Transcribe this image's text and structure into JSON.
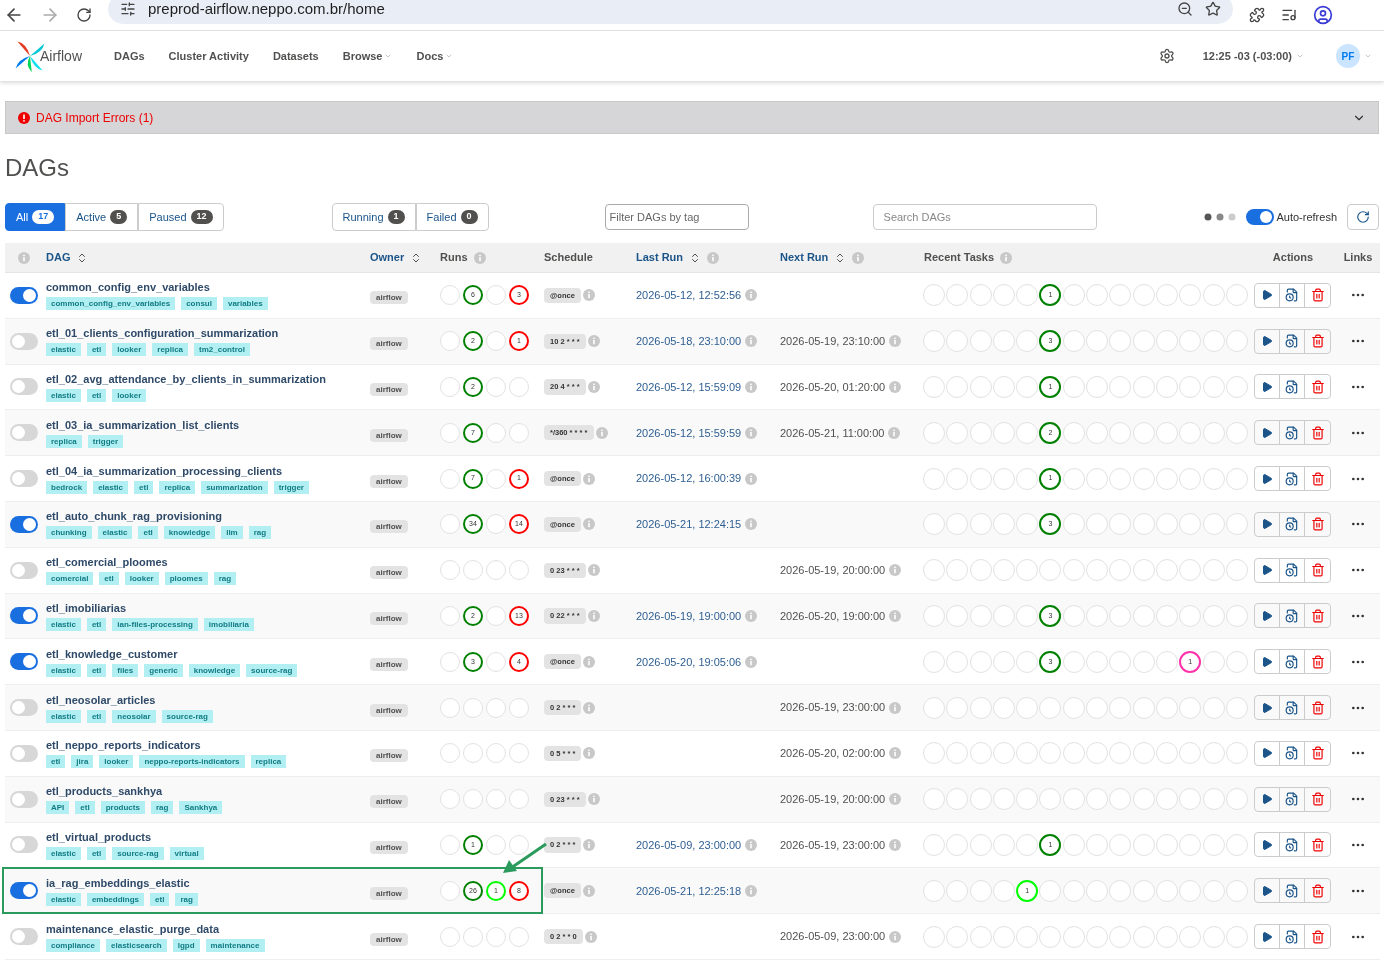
{
  "browser": {
    "url": "preprod-airflow.neppo.com.br/home"
  },
  "nav": {
    "brand": "Airflow",
    "items": [
      {
        "label": "DAGs",
        "dropdown": false
      },
      {
        "label": "Cluster Activity",
        "dropdown": false
      },
      {
        "label": "Datasets",
        "dropdown": false
      },
      {
        "label": "Browse",
        "dropdown": true
      },
      {
        "label": "Docs",
        "dropdown": true
      }
    ],
    "time": "12:25 -03 (-03:00)",
    "user": "PF"
  },
  "import_errors": {
    "label": "DAG Import Errors (1)",
    "expanded": false
  },
  "page_title": "DAGs",
  "status_filters": [
    {
      "label": "All",
      "count": "17",
      "selected": true
    },
    {
      "label": "Active",
      "count": "5",
      "selected": false
    },
    {
      "label": "Paused",
      "count": "12",
      "selected": false
    }
  ],
  "run_filters": [
    {
      "label": "Running",
      "count": "1",
      "selected": false
    },
    {
      "label": "Failed",
      "count": "0",
      "selected": false
    }
  ],
  "tag_filter": {
    "placeholder": "Filter DAGs by tag"
  },
  "search": {
    "placeholder": "Search DAGs"
  },
  "auto_refresh": {
    "label": "Auto-refresh",
    "on": true
  },
  "table": {
    "columns": [
      {
        "label": "DAG",
        "kind": "sortable"
      },
      {
        "label": "Owner",
        "kind": "sortable"
      },
      {
        "label": "Runs",
        "kind": "info"
      },
      {
        "label": "Schedule",
        "kind": "plain"
      },
      {
        "label": "Last Run",
        "kind": "sortable_info"
      },
      {
        "label": "Next Run",
        "kind": "sortable_info"
      },
      {
        "label": "Recent Tasks",
        "kind": "info"
      },
      {
        "label": "Actions",
        "kind": "plain"
      },
      {
        "label": "Links",
        "kind": "plain"
      }
    ],
    "rows": [
      {
        "dag_id": "common_config_env_variables",
        "active": true,
        "highlighted": false,
        "tags": [
          "common_config_env_variables",
          "consul",
          "variables"
        ],
        "owner": "airflow",
        "runs": [
          {
            "color": "#e2e2e2"
          },
          {
            "color": "#008000",
            "count": "6"
          },
          {
            "color": "#e2e2e2"
          },
          {
            "color": "#ff0000",
            "count": "3"
          }
        ],
        "schedule": "@once",
        "last_run": "2026-05-12, 12:52:56",
        "recent_tasks": [
          {
            "color": "#e2e2e2"
          },
          {
            "color": "#e2e2e2"
          },
          {
            "color": "#e2e2e2"
          },
          {
            "color": "#e2e2e2"
          },
          {
            "color": "#e2e2e2"
          },
          {
            "color": "#008000",
            "count": "1"
          },
          {
            "color": "#e2e2e2"
          },
          {
            "color": "#e2e2e2"
          },
          {
            "color": "#e2e2e2"
          },
          {
            "color": "#e2e2e2"
          },
          {
            "color": "#e2e2e2"
          },
          {
            "color": "#e2e2e2"
          },
          {
            "color": "#e2e2e2"
          },
          {
            "color": "#e2e2e2"
          }
        ]
      },
      {
        "dag_id": "etl_01_clients_configuration_summarization",
        "active": false,
        "highlighted": false,
        "tags": [
          "elastic",
          "etl",
          "looker",
          "replica",
          "tm2_control"
        ],
        "owner": "airflow",
        "runs": [
          {
            "color": "#e2e2e2"
          },
          {
            "color": "#008000",
            "count": "2"
          },
          {
            "color": "#e2e2e2"
          },
          {
            "color": "#ff0000",
            "count": "1"
          }
        ],
        "schedule": "10 2 * * *",
        "last_run": "2026-05-18, 23:10:00",
        "next_run": "2026-05-19, 23:10:00",
        "recent_tasks": [
          {
            "color": "#e2e2e2"
          },
          {
            "color": "#e2e2e2"
          },
          {
            "color": "#e2e2e2"
          },
          {
            "color": "#e2e2e2"
          },
          {
            "color": "#e2e2e2"
          },
          {
            "color": "#008000",
            "count": "3"
          },
          {
            "color": "#e2e2e2"
          },
          {
            "color": "#e2e2e2"
          },
          {
            "color": "#e2e2e2"
          },
          {
            "color": "#e2e2e2"
          },
          {
            "color": "#e2e2e2"
          },
          {
            "color": "#e2e2e2"
          },
          {
            "color": "#e2e2e2"
          },
          {
            "color": "#e2e2e2"
          }
        ]
      },
      {
        "dag_id": "etl_02_avg_attendance_by_clients_in_summarization",
        "active": false,
        "highlighted": false,
        "tags": [
          "elastic",
          "etl",
          "looker"
        ],
        "owner": "airflow",
        "runs": [
          {
            "color": "#e2e2e2"
          },
          {
            "color": "#008000",
            "count": "2"
          },
          {
            "color": "#e2e2e2"
          },
          {
            "color": "#e2e2e2"
          }
        ],
        "schedule": "20 4 * * *",
        "last_run": "2026-05-12, 15:59:09",
        "next_run": "2026-05-20, 01:20:00",
        "recent_tasks": [
          {
            "color": "#e2e2e2"
          },
          {
            "color": "#e2e2e2"
          },
          {
            "color": "#e2e2e2"
          },
          {
            "color": "#e2e2e2"
          },
          {
            "color": "#e2e2e2"
          },
          {
            "color": "#008000",
            "count": "1"
          },
          {
            "color": "#e2e2e2"
          },
          {
            "color": "#e2e2e2"
          },
          {
            "color": "#e2e2e2"
          },
          {
            "color": "#e2e2e2"
          },
          {
            "color": "#e2e2e2"
          },
          {
            "color": "#e2e2e2"
          },
          {
            "color": "#e2e2e2"
          },
          {
            "color": "#e2e2e2"
          }
        ]
      },
      {
        "dag_id": "etl_03_ia_summarization_list_clients",
        "active": false,
        "highlighted": false,
        "tags": [
          "replica",
          "trigger"
        ],
        "owner": "airflow",
        "runs": [
          {
            "color": "#e2e2e2"
          },
          {
            "color": "#008000",
            "count": "7"
          },
          {
            "color": "#e2e2e2"
          },
          {
            "color": "#e2e2e2"
          }
        ],
        "schedule": "*/360 * * * *",
        "last_run": "2026-05-12, 15:59:59",
        "next_run": "2026-05-21, 11:00:00",
        "recent_tasks": [
          {
            "color": "#e2e2e2"
          },
          {
            "color": "#e2e2e2"
          },
          {
            "color": "#e2e2e2"
          },
          {
            "color": "#e2e2e2"
          },
          {
            "color": "#e2e2e2"
          },
          {
            "color": "#008000",
            "count": "2"
          },
          {
            "color": "#e2e2e2"
          },
          {
            "color": "#e2e2e2"
          },
          {
            "color": "#e2e2e2"
          },
          {
            "color": "#e2e2e2"
          },
          {
            "color": "#e2e2e2"
          },
          {
            "color": "#e2e2e2"
          },
          {
            "color": "#e2e2e2"
          },
          {
            "color": "#e2e2e2"
          }
        ]
      },
      {
        "dag_id": "etl_04_ia_summarization_processing_clients",
        "active": false,
        "highlighted": false,
        "tags": [
          "bedrock",
          "elastic",
          "etl",
          "replica",
          "summarization",
          "trigger"
        ],
        "owner": "airflow",
        "runs": [
          {
            "color": "#e2e2e2"
          },
          {
            "color": "#008000",
            "count": "7"
          },
          {
            "color": "#e2e2e2"
          },
          {
            "color": "#ff0000",
            "count": "1"
          }
        ],
        "schedule": "@once",
        "last_run": "2026-05-12, 16:00:39",
        "recent_tasks": [
          {
            "color": "#e2e2e2"
          },
          {
            "color": "#e2e2e2"
          },
          {
            "color": "#e2e2e2"
          },
          {
            "color": "#e2e2e2"
          },
          {
            "color": "#e2e2e2"
          },
          {
            "color": "#008000",
            "count": "1"
          },
          {
            "color": "#e2e2e2"
          },
          {
            "color": "#e2e2e2"
          },
          {
            "color": "#e2e2e2"
          },
          {
            "color": "#e2e2e2"
          },
          {
            "color": "#e2e2e2"
          },
          {
            "color": "#e2e2e2"
          },
          {
            "color": "#e2e2e2"
          },
          {
            "color": "#e2e2e2"
          }
        ]
      },
      {
        "dag_id": "etl_auto_chunk_rag_provisioning",
        "active": true,
        "highlighted": false,
        "tags": [
          "chunking",
          "elastic",
          "etl",
          "knowledge",
          "llm",
          "rag"
        ],
        "owner": "airflow",
        "runs": [
          {
            "color": "#e2e2e2"
          },
          {
            "color": "#008000",
            "count": "34"
          },
          {
            "color": "#e2e2e2"
          },
          {
            "color": "#ff0000",
            "count": "14"
          }
        ],
        "schedule": "@once",
        "last_run": "2026-05-21, 12:24:15",
        "recent_tasks": [
          {
            "color": "#e2e2e2"
          },
          {
            "color": "#e2e2e2"
          },
          {
            "color": "#e2e2e2"
          },
          {
            "color": "#e2e2e2"
          },
          {
            "color": "#e2e2e2"
          },
          {
            "color": "#008000",
            "count": "3"
          },
          {
            "color": "#e2e2e2"
          },
          {
            "color": "#e2e2e2"
          },
          {
            "color": "#e2e2e2"
          },
          {
            "color": "#e2e2e2"
          },
          {
            "color": "#e2e2e2"
          },
          {
            "color": "#e2e2e2"
          },
          {
            "color": "#e2e2e2"
          },
          {
            "color": "#e2e2e2"
          }
        ]
      },
      {
        "dag_id": "etl_comercial_ploomes",
        "active": false,
        "highlighted": false,
        "tags": [
          "comercial",
          "etl",
          "looker",
          "ploomes",
          "rag"
        ],
        "owner": "airflow",
        "runs": [
          {
            "color": "#e2e2e2"
          },
          {
            "color": "#e2e2e2"
          },
          {
            "color": "#e2e2e2"
          },
          {
            "color": "#e2e2e2"
          }
        ],
        "schedule": "0 23 * * *",
        "next_run": "2026-05-19, 20:00:00",
        "recent_tasks": [
          {
            "color": "#e2e2e2"
          },
          {
            "color": "#e2e2e2"
          },
          {
            "color": "#e2e2e2"
          },
          {
            "color": "#e2e2e2"
          },
          {
            "color": "#e2e2e2"
          },
          {
            "color": "#e2e2e2"
          },
          {
            "color": "#e2e2e2"
          },
          {
            "color": "#e2e2e2"
          },
          {
            "color": "#e2e2e2"
          },
          {
            "color": "#e2e2e2"
          },
          {
            "color": "#e2e2e2"
          },
          {
            "color": "#e2e2e2"
          },
          {
            "color": "#e2e2e2"
          },
          {
            "color": "#e2e2e2"
          }
        ]
      },
      {
        "dag_id": "etl_imobiliarias",
        "active": true,
        "highlighted": false,
        "tags": [
          "elastic",
          "etl",
          "ian-files-processing",
          "imobiliaria"
        ],
        "owner": "airflow",
        "runs": [
          {
            "color": "#e2e2e2"
          },
          {
            "color": "#008000",
            "count": "2"
          },
          {
            "color": "#e2e2e2"
          },
          {
            "color": "#ff0000",
            "count": "13"
          }
        ],
        "schedule": "0 22 * * *",
        "last_run": "2026-05-19, 19:00:00",
        "next_run": "2026-05-20, 19:00:00",
        "recent_tasks": [
          {
            "color": "#e2e2e2"
          },
          {
            "color": "#e2e2e2"
          },
          {
            "color": "#e2e2e2"
          },
          {
            "color": "#e2e2e2"
          },
          {
            "color": "#e2e2e2"
          },
          {
            "color": "#008000",
            "count": "3"
          },
          {
            "color": "#e2e2e2"
          },
          {
            "color": "#e2e2e2"
          },
          {
            "color": "#e2e2e2"
          },
          {
            "color": "#e2e2e2"
          },
          {
            "color": "#e2e2e2"
          },
          {
            "color": "#e2e2e2"
          },
          {
            "color": "#e2e2e2"
          },
          {
            "color": "#e2e2e2"
          }
        ]
      },
      {
        "dag_id": "etl_knowledge_customer",
        "active": true,
        "highlighted": false,
        "tags": [
          "elastic",
          "etl",
          "files",
          "generic",
          "knowledge",
          "source-rag"
        ],
        "owner": "airflow",
        "runs": [
          {
            "color": "#e2e2e2"
          },
          {
            "color": "#008000",
            "count": "3"
          },
          {
            "color": "#e2e2e2"
          },
          {
            "color": "#ff0000",
            "count": "4"
          }
        ],
        "schedule": "@once",
        "last_run": "2026-05-20, 19:05:06",
        "recent_tasks": [
          {
            "color": "#e2e2e2"
          },
          {
            "color": "#e2e2e2"
          },
          {
            "color": "#e2e2e2"
          },
          {
            "color": "#e2e2e2"
          },
          {
            "color": "#e2e2e2"
          },
          {
            "color": "#008000",
            "count": "3"
          },
          {
            "color": "#e2e2e2"
          },
          {
            "color": "#e2e2e2"
          },
          {
            "color": "#e2e2e2"
          },
          {
            "color": "#e2e2e2"
          },
          {
            "color": "#e2e2e2"
          },
          {
            "color": "#ff33aa",
            "count": "1"
          },
          {
            "color": "#e2e2e2"
          },
          {
            "color": "#e2e2e2"
          }
        ]
      },
      {
        "dag_id": "etl_neosolar_articles",
        "active": false,
        "highlighted": false,
        "tags": [
          "elastic",
          "etl",
          "neosolar",
          "source-rag"
        ],
        "owner": "airflow",
        "runs": [
          {
            "color": "#e2e2e2"
          },
          {
            "color": "#e2e2e2"
          },
          {
            "color": "#e2e2e2"
          },
          {
            "color": "#e2e2e2"
          }
        ],
        "schedule": "0 2 * * *",
        "next_run": "2026-05-19, 23:00:00",
        "recent_tasks": [
          {
            "color": "#e2e2e2"
          },
          {
            "color": "#e2e2e2"
          },
          {
            "color": "#e2e2e2"
          },
          {
            "color": "#e2e2e2"
          },
          {
            "color": "#e2e2e2"
          },
          {
            "color": "#e2e2e2"
          },
          {
            "color": "#e2e2e2"
          },
          {
            "color": "#e2e2e2"
          },
          {
            "color": "#e2e2e2"
          },
          {
            "color": "#e2e2e2"
          },
          {
            "color": "#e2e2e2"
          },
          {
            "color": "#e2e2e2"
          },
          {
            "color": "#e2e2e2"
          },
          {
            "color": "#e2e2e2"
          }
        ]
      },
      {
        "dag_id": "etl_neppo_reports_indicators",
        "active": false,
        "highlighted": false,
        "tags": [
          "etl",
          "jira",
          "looker",
          "neppo-reports-indicators",
          "replica"
        ],
        "owner": "airflow",
        "runs": [
          {
            "color": "#e2e2e2"
          },
          {
            "color": "#e2e2e2"
          },
          {
            "color": "#e2e2e2"
          },
          {
            "color": "#e2e2e2"
          }
        ],
        "schedule": "0 5 * * *",
        "next_run": "2026-05-20, 02:00:00",
        "recent_tasks": [
          {
            "color": "#e2e2e2"
          },
          {
            "color": "#e2e2e2"
          },
          {
            "color": "#e2e2e2"
          },
          {
            "color": "#e2e2e2"
          },
          {
            "color": "#e2e2e2"
          },
          {
            "color": "#e2e2e2"
          },
          {
            "color": "#e2e2e2"
          },
          {
            "color": "#e2e2e2"
          },
          {
            "color": "#e2e2e2"
          },
          {
            "color": "#e2e2e2"
          },
          {
            "color": "#e2e2e2"
          },
          {
            "color": "#e2e2e2"
          },
          {
            "color": "#e2e2e2"
          },
          {
            "color": "#e2e2e2"
          }
        ]
      },
      {
        "dag_id": "etl_products_sankhya",
        "active": false,
        "highlighted": false,
        "tags": [
          "API",
          "etl",
          "products",
          "rag",
          "Sankhya"
        ],
        "owner": "airflow",
        "runs": [
          {
            "color": "#e2e2e2"
          },
          {
            "color": "#e2e2e2"
          },
          {
            "color": "#e2e2e2"
          },
          {
            "color": "#e2e2e2"
          }
        ],
        "schedule": "0 23 * * *",
        "next_run": "2026-05-19, 20:00:00",
        "recent_tasks": [
          {
            "color": "#e2e2e2"
          },
          {
            "color": "#e2e2e2"
          },
          {
            "color": "#e2e2e2"
          },
          {
            "color": "#e2e2e2"
          },
          {
            "color": "#e2e2e2"
          },
          {
            "color": "#e2e2e2"
          },
          {
            "color": "#e2e2e2"
          },
          {
            "color": "#e2e2e2"
          },
          {
            "color": "#e2e2e2"
          },
          {
            "color": "#e2e2e2"
          },
          {
            "color": "#e2e2e2"
          },
          {
            "color": "#e2e2e2"
          },
          {
            "color": "#e2e2e2"
          },
          {
            "color": "#e2e2e2"
          }
        ]
      },
      {
        "dag_id": "etl_virtual_products",
        "active": false,
        "highlighted": false,
        "tags": [
          "elastic",
          "etl",
          "source-rag",
          "virtual"
        ],
        "owner": "airflow",
        "runs": [
          {
            "color": "#e2e2e2"
          },
          {
            "color": "#008000",
            "count": "1"
          },
          {
            "color": "#e2e2e2"
          },
          {
            "color": "#e2e2e2"
          }
        ],
        "schedule": "0 2 * * *",
        "last_run": "2026-05-09, 23:00:00",
        "next_run": "2026-05-19, 23:00:00",
        "recent_tasks": [
          {
            "color": "#e2e2e2"
          },
          {
            "color": "#e2e2e2"
          },
          {
            "color": "#e2e2e2"
          },
          {
            "color": "#e2e2e2"
          },
          {
            "color": "#e2e2e2"
          },
          {
            "color": "#008000",
            "count": "1"
          },
          {
            "color": "#e2e2e2"
          },
          {
            "color": "#e2e2e2"
          },
          {
            "color": "#e2e2e2"
          },
          {
            "color": "#e2e2e2"
          },
          {
            "color": "#e2e2e2"
          },
          {
            "color": "#e2e2e2"
          },
          {
            "color": "#e2e2e2"
          },
          {
            "color": "#e2e2e2"
          }
        ]
      },
      {
        "dag_id": "ia_rag_embeddings_elastic",
        "active": true,
        "highlighted": true,
        "tags": [
          "elastic",
          "embeddings",
          "etl",
          "rag"
        ],
        "owner": "airflow",
        "runs": [
          {
            "color": "#e2e2e2"
          },
          {
            "color": "#008000",
            "count": "26"
          },
          {
            "color": "#00ff00",
            "count": "1"
          },
          {
            "color": "#ff0000",
            "count": "8"
          }
        ],
        "schedule": "@once",
        "last_run": "2026-05-21, 12:25:18",
        "recent_tasks": [
          {
            "color": "#e2e2e2"
          },
          {
            "color": "#e2e2e2"
          },
          {
            "color": "#e2e2e2"
          },
          {
            "color": "#e2e2e2"
          },
          {
            "color": "#00ff00",
            "count": "1"
          },
          {
            "color": "#e2e2e2"
          },
          {
            "color": "#e2e2e2"
          },
          {
            "color": "#e2e2e2"
          },
          {
            "color": "#e2e2e2"
          },
          {
            "color": "#e2e2e2"
          },
          {
            "color": "#e2e2e2"
          },
          {
            "color": "#e2e2e2"
          },
          {
            "color": "#e2e2e2"
          },
          {
            "color": "#e2e2e2"
          }
        ]
      },
      {
        "dag_id": "maintenance_elastic_purge_data",
        "active": false,
        "highlighted": false,
        "tags": [
          "compliance",
          "elasticsearch",
          "lgpd",
          "maintenance"
        ],
        "owner": "airflow",
        "runs": [
          {
            "color": "#e2e2e2"
          },
          {
            "color": "#e2e2e2"
          },
          {
            "color": "#e2e2e2"
          },
          {
            "color": "#e2e2e2"
          }
        ],
        "schedule": "0 2 * * 0",
        "next_run": "2026-05-09, 23:00:00",
        "recent_tasks": [
          {
            "color": "#e2e2e2"
          },
          {
            "color": "#e2e2e2"
          },
          {
            "color": "#e2e2e2"
          },
          {
            "color": "#e2e2e2"
          },
          {
            "color": "#e2e2e2"
          },
          {
            "color": "#e2e2e2"
          },
          {
            "color": "#e2e2e2"
          },
          {
            "color": "#e2e2e2"
          },
          {
            "color": "#e2e2e2"
          },
          {
            "color": "#e2e2e2"
          },
          {
            "color": "#e2e2e2"
          },
          {
            "color": "#e2e2e2"
          },
          {
            "color": "#e2e2e2"
          },
          {
            "color": "#e2e2e2"
          }
        ]
      }
    ]
  }
}
